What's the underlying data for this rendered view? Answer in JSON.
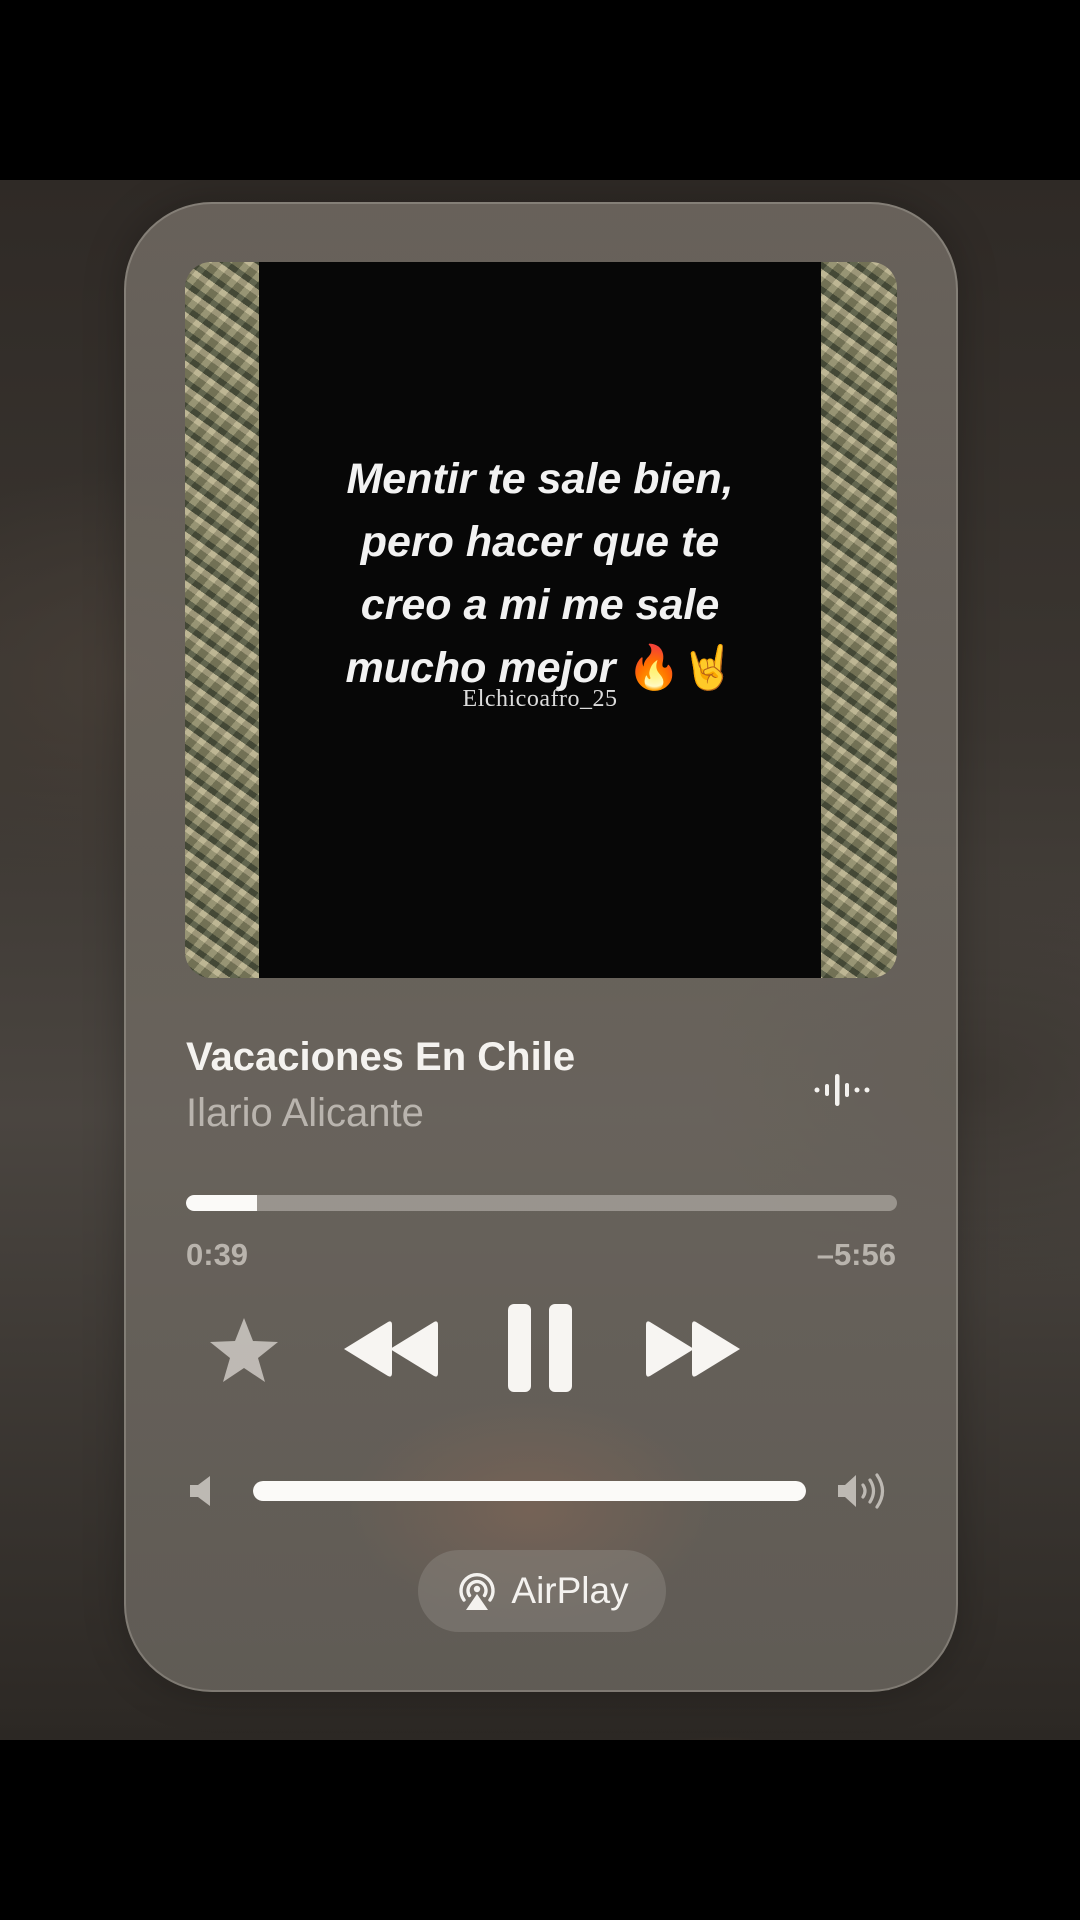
{
  "artwork": {
    "quote_lines": [
      "Mentir te sale bien,",
      "pero hacer que te",
      "creo a mi me sale",
      "mucho mejor"
    ],
    "emoji_fire": "🔥",
    "emoji_hand": "🤘",
    "signature": "Elchicoafro_25"
  },
  "track": {
    "title": "Vacaciones En Chile",
    "artist": "Ilario Alicante"
  },
  "playback": {
    "elapsed": "0:39",
    "remaining": "–5:56",
    "progress_fraction": 0.1,
    "volume_fraction": 1.0
  },
  "icons": {
    "favorite": "star-icon",
    "previous": "rewind-icon",
    "play_pause": "pause-icon",
    "next": "fast-forward-icon",
    "waveform": "waveform-icon",
    "volume_low": "speaker-low-icon",
    "volume_high": "speaker-high-icon",
    "airplay": "airplay-icon"
  },
  "airplay": {
    "label": "AirPlay"
  },
  "colors": {
    "primary_text": "#f4f2ef",
    "secondary_text": "#a8a39d",
    "fill": "#fbfaf8"
  }
}
